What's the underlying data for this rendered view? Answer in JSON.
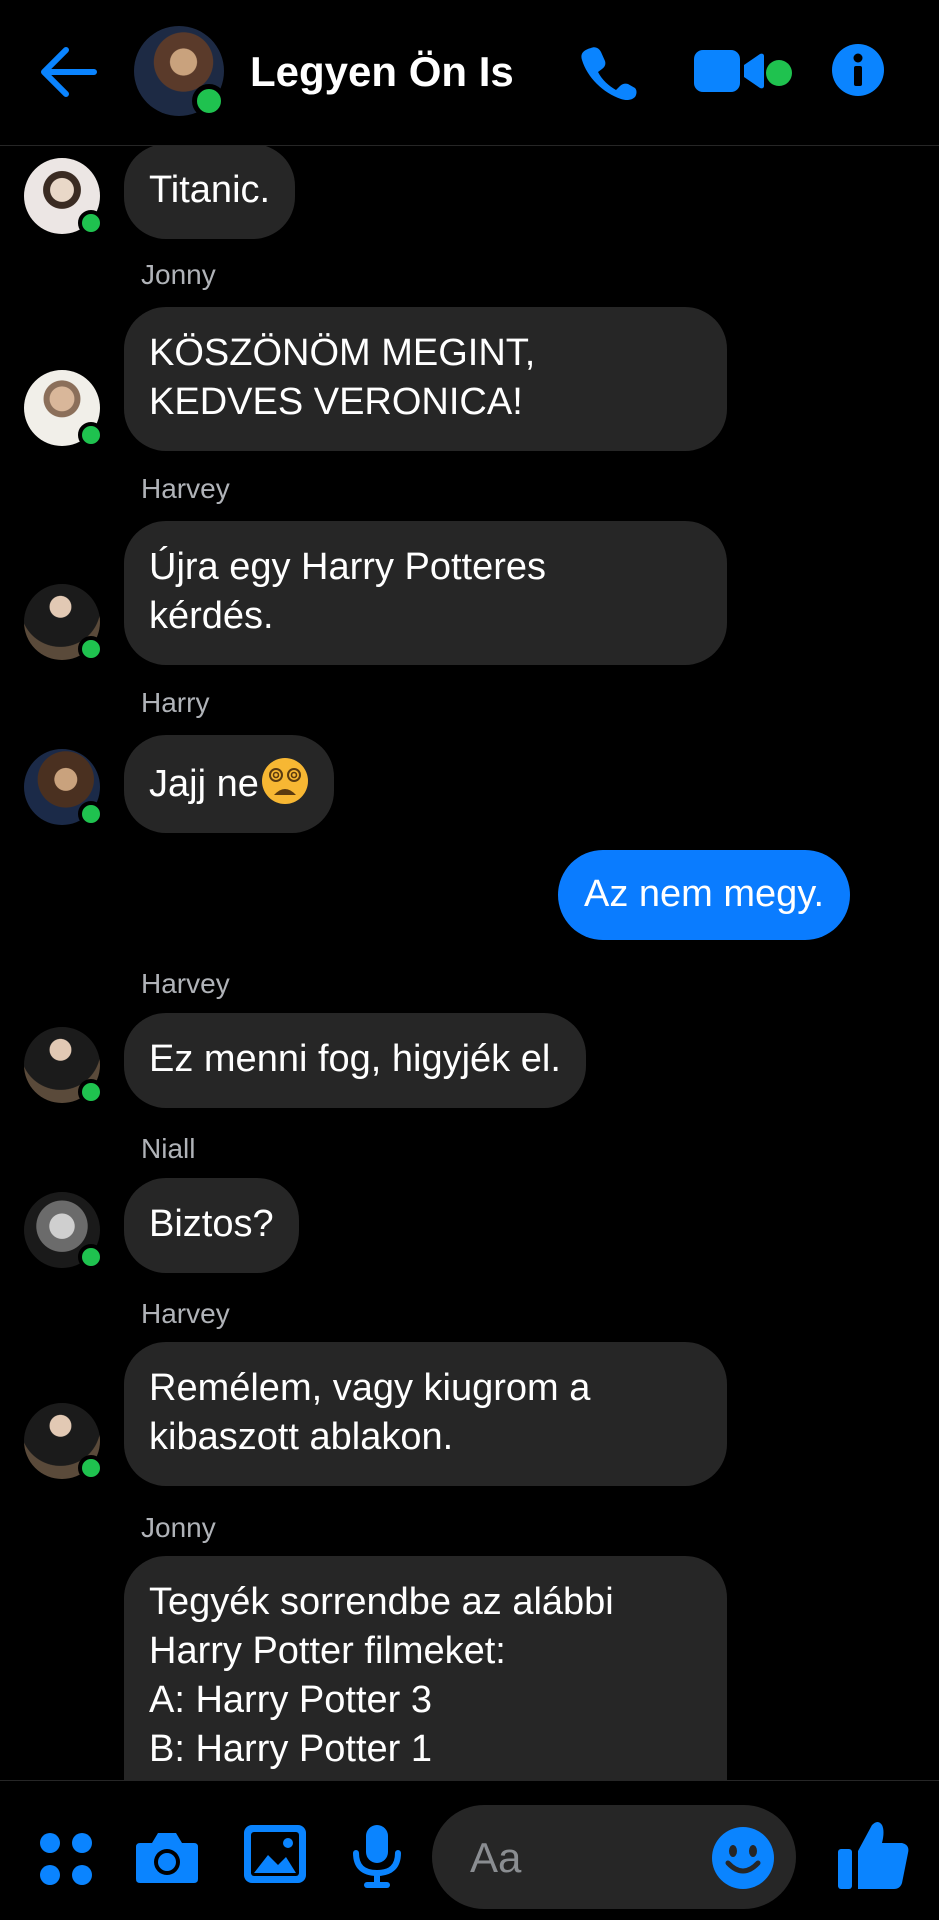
{
  "header": {
    "title": "Legyen Ön Is"
  },
  "messages": [
    {
      "sender": "",
      "text_lines": [
        "Titanic."
      ],
      "avatar": "woman-avatar"
    },
    {
      "sender": "Jonny",
      "text_lines": [
        "KÖSZÖNÖM MEGINT,",
        "KEDVES VERONICA!"
      ],
      "avatar": "jonny-avatar"
    },
    {
      "sender": "Harvey",
      "text_lines": [
        "Újra egy Harry Potteres",
        "kérdés."
      ],
      "avatar": "harvey-avatar"
    },
    {
      "sender": "Harry",
      "text_lines": [
        "Jajj ne"
      ],
      "avatar": "harry-avatar",
      "emoji": "dizzy-face-emoji"
    },
    {
      "sender": "",
      "text_lines": [
        "Az nem megy."
      ],
      "outgoing": true
    },
    {
      "sender": "Harvey",
      "text_lines": [
        "Ez menni fog, higyjék el."
      ],
      "avatar": "harvey-avatar"
    },
    {
      "sender": "Niall",
      "text_lines": [
        "Biztos?"
      ],
      "avatar": "niall-avatar"
    },
    {
      "sender": "Harvey",
      "text_lines": [
        "Remélem, vagy kiugrom a",
        "kibaszott ablakon."
      ],
      "avatar": "harvey-avatar"
    },
    {
      "sender": "Jonny",
      "text_lines": [
        "Tegyék sorrendbe az alábbi",
        "Harry Potter filmeket:",
        "A: Harry Potter 3",
        "B: Harry Potter 1"
      ],
      "avatar": "jonny-avatar"
    }
  ],
  "composer": {
    "placeholder": "Aa"
  },
  "icons": {
    "back": "arrow-left-icon",
    "call": "phone-icon",
    "video": "video-camera-icon",
    "info": "info-icon",
    "menu": "four-dots-icon",
    "camera": "camera-icon",
    "gallery": "image-icon",
    "mic": "microphone-icon",
    "emoji": "smiley-icon",
    "like": "thumbs-up-icon"
  },
  "colors": {
    "accent": "#0a7cff",
    "bubble_in": "#262626",
    "online": "#1fc24f",
    "background": "#000000"
  }
}
